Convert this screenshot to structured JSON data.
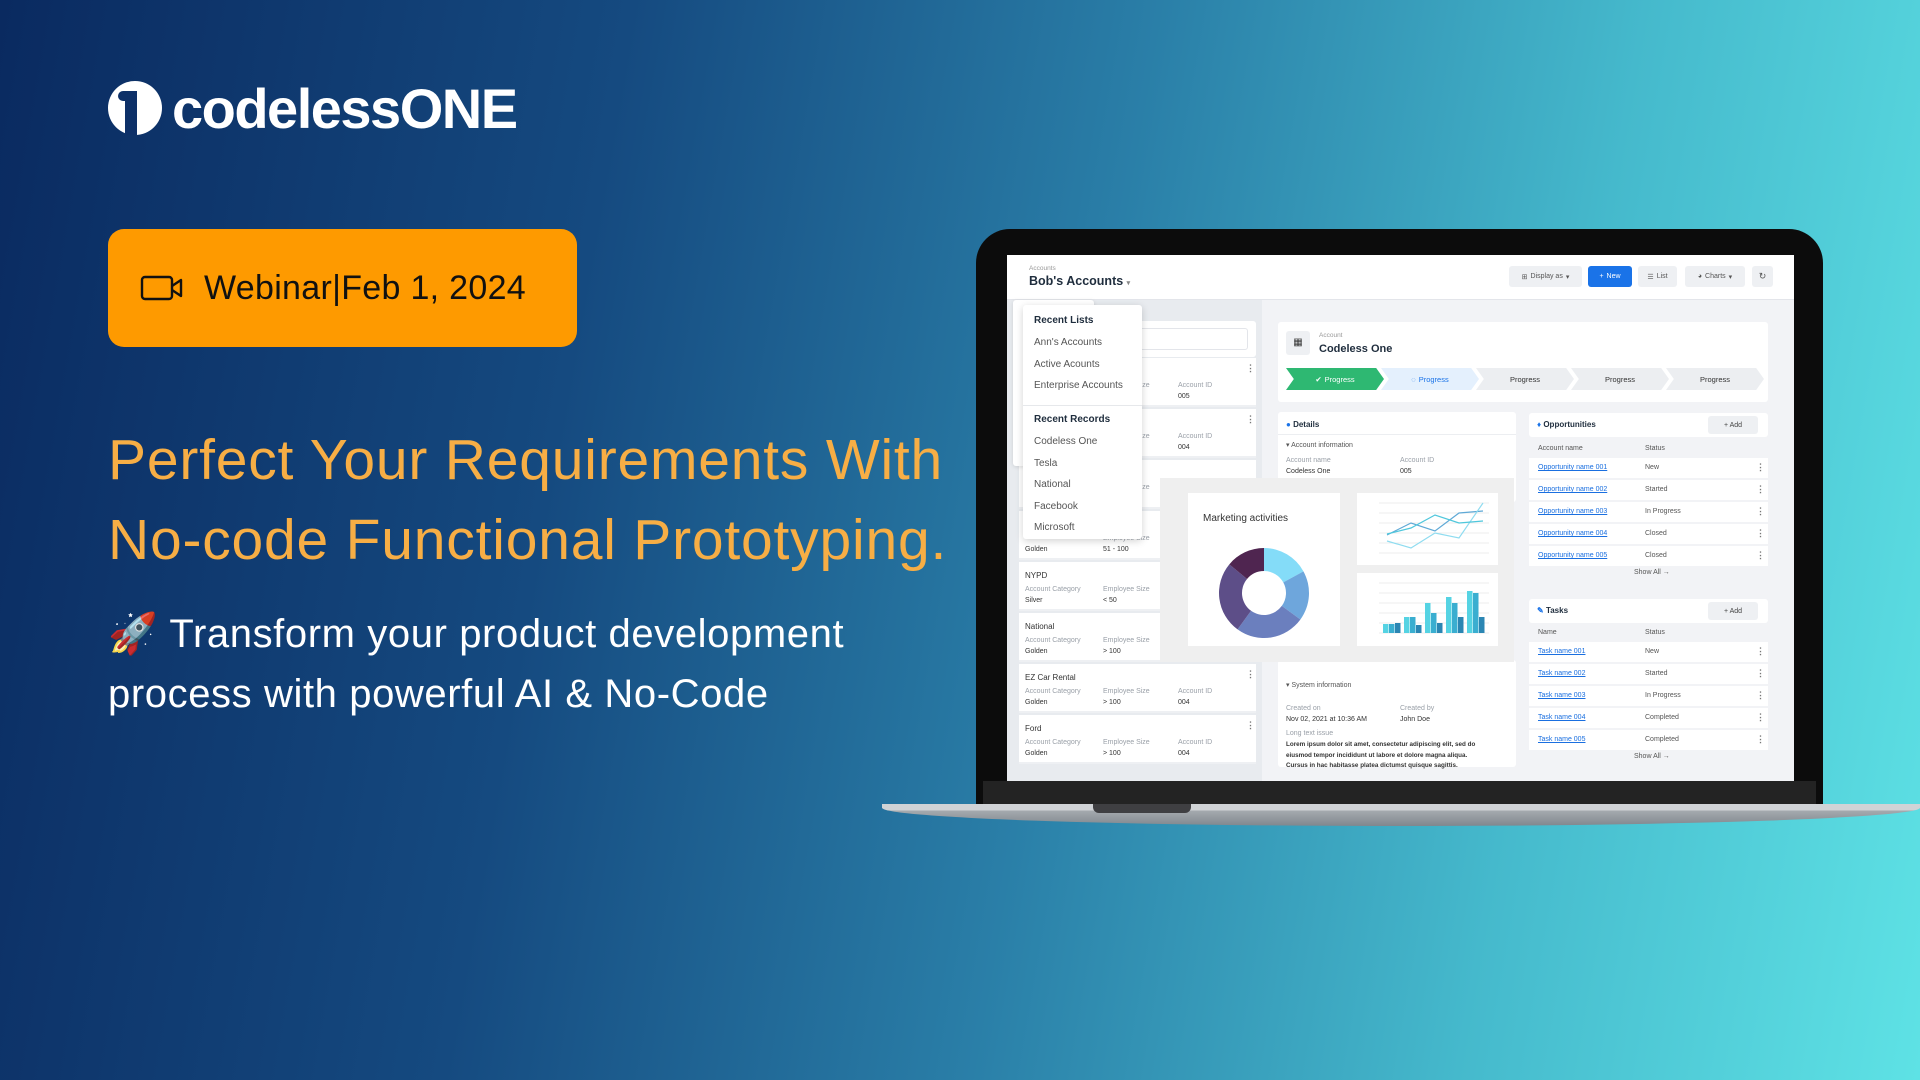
{
  "brand": {
    "name": "codelessONE",
    "logo_icon": "one-circle-logo"
  },
  "badge": {
    "icon": "video-camera-icon",
    "text": "Webinar|Feb 1, 2024",
    "color": "#fe9a00"
  },
  "headline": {
    "line1": "Perfect Your Requirements With",
    "line2": "No-code Functional Prototyping.",
    "color": "#f7ae45"
  },
  "subheadline": {
    "emoji": "🚀",
    "line1": "Transform your product development",
    "line2": "process with powerful AI & No-Code"
  },
  "app": {
    "breadcrumb": "Accounts",
    "title": "Bob's Accounts",
    "toolbar": {
      "display_as": "Display as",
      "new": "New",
      "list": "List",
      "charts": "Charts",
      "refresh_icon": "refresh-icon",
      "accent": "#1a73e8"
    },
    "dropdown": {
      "recent_lists_title": "Recent Lists",
      "recent_lists": [
        "Ann's Accounts",
        "Active Acounts",
        "Enterprise Accounts"
      ],
      "recent_records_title": "Recent Records",
      "recent_records": [
        "Codeless One",
        "Tesla",
        "National",
        "Facebook",
        "Microsoft"
      ]
    },
    "account_list": [
      {
        "name": "",
        "category_label": "",
        "category": "",
        "size_label": "Employee Size",
        "size": "",
        "id_label": "Account ID",
        "id": "005"
      },
      {
        "name": "",
        "category_label": "",
        "category": "",
        "size_label": "Employee Size",
        "size": "",
        "id_label": "Account ID",
        "id": "004"
      },
      {
        "name": "",
        "category_label": "",
        "category": "",
        "size_label": "Employee Size",
        "size": "",
        "id_label": "",
        "id": ""
      },
      {
        "name": "",
        "category_label": "",
        "category": "Golden",
        "size_label": "Employee Size",
        "size": "51 - 100",
        "id_label": "",
        "id": ""
      },
      {
        "name": "NYPD",
        "category_label": "Account Category",
        "category": "Silver",
        "size_label": "Employee Size",
        "size": "< 50",
        "id_label": "",
        "id": ""
      },
      {
        "name": "National",
        "category_label": "Account Category",
        "category": "Golden",
        "size_label": "Employee Size",
        "size": "> 100",
        "id_label": "",
        "id": ""
      },
      {
        "name": "EZ Car Rental",
        "category_label": "Account Category",
        "category": "Golden",
        "size_label": "Employee Size",
        "size": "> 100",
        "id_label": "Account ID",
        "id": "004"
      },
      {
        "name": "Ford",
        "category_label": "Account Category",
        "category": "Golden",
        "size_label": "Employee Size",
        "size": "> 100",
        "id_label": "Account ID",
        "id": "004"
      }
    ],
    "record": {
      "type_label": "Account",
      "name": "Codeless One",
      "steps": [
        {
          "label": "Progress",
          "state": "done"
        },
        {
          "label": "Progress",
          "state": "active"
        },
        {
          "label": "Progress",
          "state": "todo"
        },
        {
          "label": "Progress",
          "state": "todo"
        },
        {
          "label": "Progress",
          "state": "todo"
        }
      ],
      "details": {
        "title": "Details",
        "section": "Account information",
        "account_name_label": "Account name",
        "account_name": "Codeless One",
        "account_id_label": "Account ID",
        "account_id": "005"
      },
      "system": {
        "section": "System information",
        "created_on_label": "Created on",
        "created_on": "Nov 02, 2021 at 10:36 AM",
        "created_by_label": "Created by",
        "created_by": "John Doe",
        "long_text_label": "Long text issue",
        "long_text": [
          "Lorem ipsum dolor sit amet, consectetur adipiscing elit, sed do",
          "eiusmod tempor incididunt ut labore et dolore magna aliqua.",
          "Cursus in hac habitasse platea dictumst quisque sagittis."
        ]
      }
    },
    "opportunities": {
      "title": "Opportunities",
      "add": "+ Add",
      "col_name": "Account name",
      "col_status": "Status",
      "show_all": "Show All →",
      "rows": [
        {
          "name": "Opportunity name 001",
          "status": "New"
        },
        {
          "name": "Opportunity name 002",
          "status": "Started"
        },
        {
          "name": "Opportunity name 003",
          "status": "In Progress"
        },
        {
          "name": "Opportunity name 004",
          "status": "Closed"
        },
        {
          "name": "Opportunity name 005",
          "status": "Closed"
        }
      ]
    },
    "tasks": {
      "title": "Tasks",
      "add": "+ Add",
      "col_name": "Name",
      "col_status": "Status",
      "show_all": "Show All →",
      "rows": [
        {
          "name": "Task name 001",
          "status": "New"
        },
        {
          "name": "Task name 002",
          "status": "Started"
        },
        {
          "name": "Task name 003",
          "status": "In Progress"
        },
        {
          "name": "Task name 004",
          "status": "Completed"
        },
        {
          "name": "Task name 005",
          "status": "Completed"
        }
      ]
    },
    "marketing": {
      "title": "Marketing activities",
      "donut": {
        "values": [
          17,
          18,
          25,
          26,
          14
        ],
        "colors": [
          "#84dcf8",
          "#6ea6dc",
          "#6b7fbe",
          "#5d4e88",
          "#4f2550"
        ]
      },
      "line_chart": {
        "ylim": [
          0,
          50
        ],
        "series": [
          [
            18,
            30,
            22,
            40,
            42
          ],
          [
            12,
            5,
            20,
            15,
            50
          ],
          [
            19,
            25,
            38,
            30,
            32
          ]
        ],
        "colors": [
          "#5fa9d6",
          "#8fdcf0",
          "#4fc7dc"
        ]
      },
      "bar_chart": {
        "ylim": [
          0,
          25
        ],
        "series": [
          [
            4.5,
            8,
            15,
            18,
            21
          ],
          [
            4.5,
            8,
            10,
            15,
            20
          ],
          [
            5,
            4,
            5,
            8,
            8
          ]
        ],
        "colors": [
          "#55d3e3",
          "#3aaed0",
          "#2b86b3"
        ]
      }
    }
  }
}
